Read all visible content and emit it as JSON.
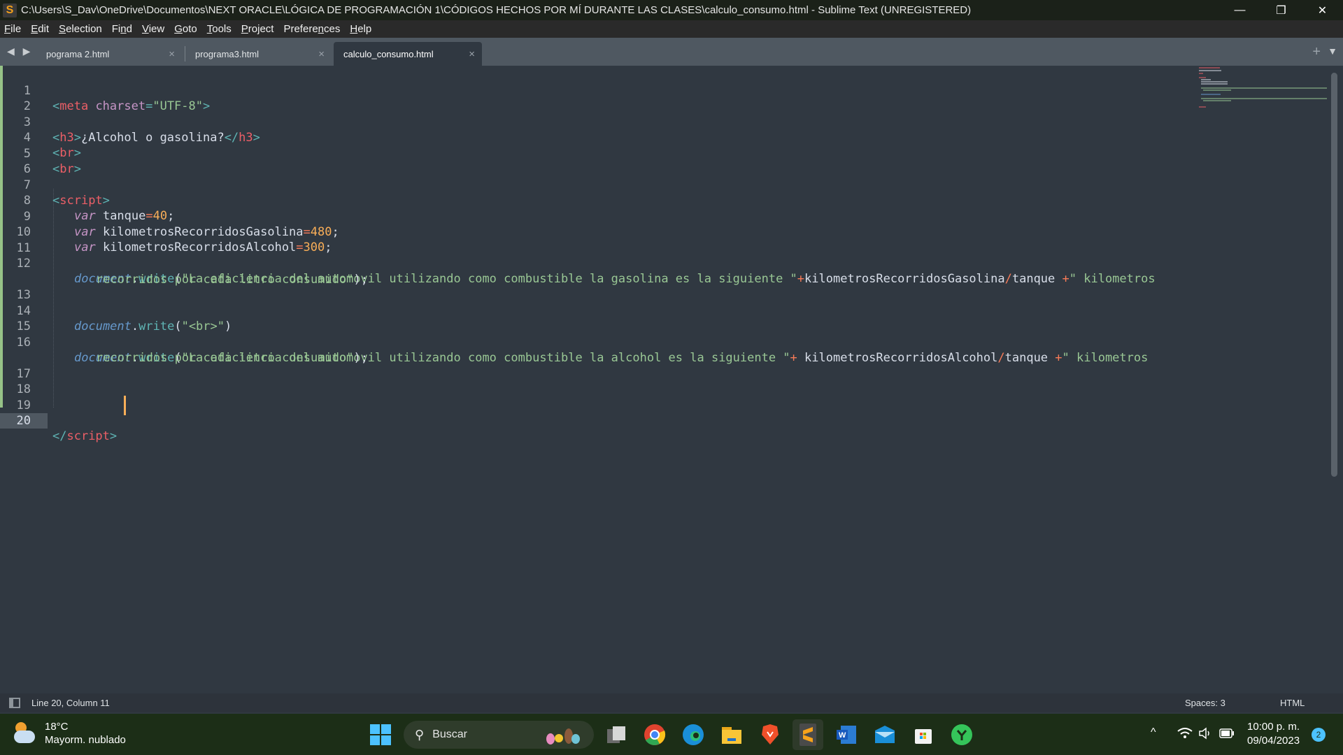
{
  "window": {
    "title": "C:\\Users\\S_Dav\\OneDrive\\Documentos\\NEXT ORACLE\\LÓGICA DE PROGRAMACIÓN 1\\CÓDIGOS HECHOS POR MÍ DURANTE LAS CLASES\\calculo_consumo.html - Sublime Text (UNREGISTERED)",
    "app_icon": "sublime-text-icon",
    "controls": {
      "minimize": "—",
      "maximize": "❐",
      "close": "✕"
    }
  },
  "menu": [
    {
      "label": "File",
      "ul": "F",
      "rest": "ile"
    },
    {
      "label": "Edit",
      "ul": "E",
      "rest": "dit"
    },
    {
      "label": "Selection",
      "ul": "S",
      "rest": "election"
    },
    {
      "label": "Find",
      "pre": "Fi",
      "ul": "n",
      "rest": "d"
    },
    {
      "label": "View",
      "ul": "V",
      "rest": "iew"
    },
    {
      "label": "Goto",
      "ul": "G",
      "rest": "oto"
    },
    {
      "label": "Tools",
      "ul": "T",
      "rest": "ools"
    },
    {
      "label": "Project",
      "ul": "P",
      "rest": "roject"
    },
    {
      "label": "Preferences",
      "pre": "Prefere",
      "ul": "n",
      "rest": "ces"
    },
    {
      "label": "Help",
      "ul": "H",
      "rest": "elp"
    }
  ],
  "tabs": [
    {
      "label": "pograma 2.html",
      "close": "×",
      "active": false
    },
    {
      "label": "programa3.html",
      "close": "×",
      "active": false
    },
    {
      "label": "calculo_consumo.html",
      "close": "×",
      "active": true
    }
  ],
  "tabbar": {
    "nav": "◀ ▶",
    "new_tab": "+",
    "dropdown": "▼"
  },
  "editor": {
    "line_numbers": [
      "1",
      "2",
      "3",
      "4",
      "5",
      "6",
      "7",
      "8",
      "9",
      "10",
      "11",
      "12",
      "13",
      "14",
      "15",
      "16",
      "17",
      "18",
      "19",
      "20"
    ],
    "current_line": "20",
    "code": {
      "l1": {
        "open": "<",
        "tag": "meta",
        "attr": " charset",
        "eq": "=",
        "val": "\"UTF-8\"",
        "close": ">"
      },
      "l3": {
        "open": "<",
        "tag": "h3",
        "close": ">",
        "text": "¿Alcohol o gasolina?",
        "open2": "</",
        "tag2": "h3",
        "close2": ">"
      },
      "l4": {
        "open": "<",
        "tag": "br",
        "close": ">"
      },
      "l5": {
        "open": "<",
        "tag": "br",
        "close": ">"
      },
      "l7": {
        "open": "<",
        "tag": "script",
        "close": ">"
      },
      "l8": {
        "kw": "var",
        "name": " tanque",
        "op": "=",
        "num": "40",
        "end": ";"
      },
      "l9": {
        "kw": "var",
        "name": " kilometrosRecorridosGasolina",
        "op": "=",
        "num": "480",
        "end": ";"
      },
      "l10": {
        "kw": "var",
        "name": " kilometrosRecorridosAlcohol",
        "op": "=",
        "num": "300",
        "end": ";"
      },
      "l12": {
        "obj": "document",
        "dot": ".",
        "fn": "write",
        "paren": "(",
        "str": "\"La eficiencia del automovil utilizando como combustible la gasolina es la siguiente \"",
        "plus1": "+",
        "var1": "kilometrosRecorridosGasolina",
        "div": "/",
        "var2": "tanque ",
        "plus2": "+",
        "str2": "\" kilometros",
        "wrap": "recorridos por cada litro consumido\"",
        "end": ");"
      },
      "l14": {
        "obj": "document",
        "dot": ".",
        "fn": "write",
        "paren": "(",
        "str": "\"<br>\"",
        "end": ")"
      },
      "l16": {
        "obj": "document",
        "dot": ".",
        "fn": "write",
        "paren": "(",
        "str": "\"La eficiencia del automovil utilizando como combustible la alcohol es la siguiente \"",
        "plus1": "+",
        "var1": " kilometrosRecorridosAlcohol",
        "div": "/",
        "var2": "tanque ",
        "plus2": "+",
        "str2": "\" kilometros",
        "wrap": "recorridos por cada litro consumido\"",
        "end": ");"
      },
      "l20": {
        "open": "</",
        "tag": "script",
        "close": ">"
      }
    }
  },
  "statusbar": {
    "position": "Line 20, Column 11",
    "indentation": "Spaces: 3",
    "syntax": "HTML"
  },
  "taskbar": {
    "weather": {
      "temp": "18°C",
      "desc": "Mayorm. nublado"
    },
    "search_placeholder": "Buscar",
    "apps": [
      "start-menu",
      "task-view",
      "chrome",
      "edge",
      "file-explorer",
      "brave",
      "sublime-text",
      "word",
      "mail",
      "microsoft-store",
      "app-green"
    ],
    "tray": {
      "chevron": "^",
      "wifi": "wifi-icon",
      "volume": "volume-icon",
      "battery": "battery-icon"
    },
    "clock": {
      "time": "10:00 p. m.",
      "date": "09/04/2023"
    },
    "notifications": "2"
  }
}
